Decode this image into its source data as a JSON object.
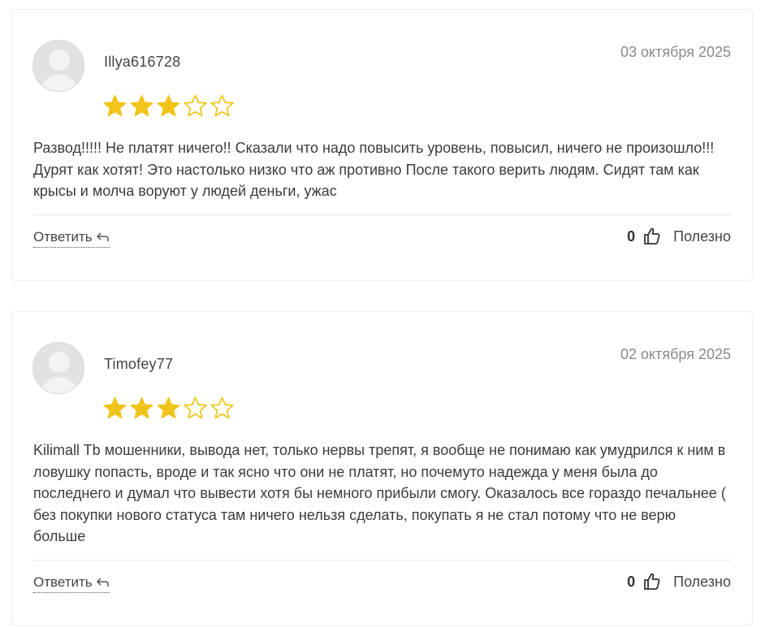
{
  "reviews": [
    {
      "author": "Illya616728",
      "date": "03 октября 2025",
      "rating": 3,
      "max_rating": 5,
      "text": "Развод!!!!! Не платят ничего!! Сказали что надо повысить уровень, повысил, ничего не произошло!!! Дурят как хотят! Это настолько низко что аж противно После такого верить людям. Сидят там как крысы и молча воруют у людей деньги, ужас",
      "reply_label": "Ответить",
      "helpful_count": "0",
      "helpful_label": "Полезно"
    },
    {
      "author": "Timofey77",
      "date": "02 октября 2025",
      "rating": 3,
      "max_rating": 5,
      "text": "Kilimall Tb мошенники, вывода нет, только нервы трепят, я вообще не понимаю как умудрился к ним в ловушку попасть, вроде и так ясно что они не платят, но почемуто надежда у меня была до последнего и думал что вывести хотя бы немного прибыли смогу. Оказалось все гораздо печальнее ( без покупки нового статуса там ничего нельзя сделать, покупать я не стал потому что не верю больше",
      "reply_label": "Ответить",
      "helpful_count": "0",
      "helpful_label": "Полезно"
    }
  ],
  "colors": {
    "star_filled": "#f0c419",
    "star_empty_stroke": "#f0c419",
    "text": "#3c3c3c",
    "date": "#8a8a8a",
    "border": "#ececec"
  },
  "icons": {
    "avatar": "default-user-avatar",
    "star": "star-icon",
    "reply": "reply-arrow-icon",
    "helpful": "thumbs-up-icon"
  }
}
